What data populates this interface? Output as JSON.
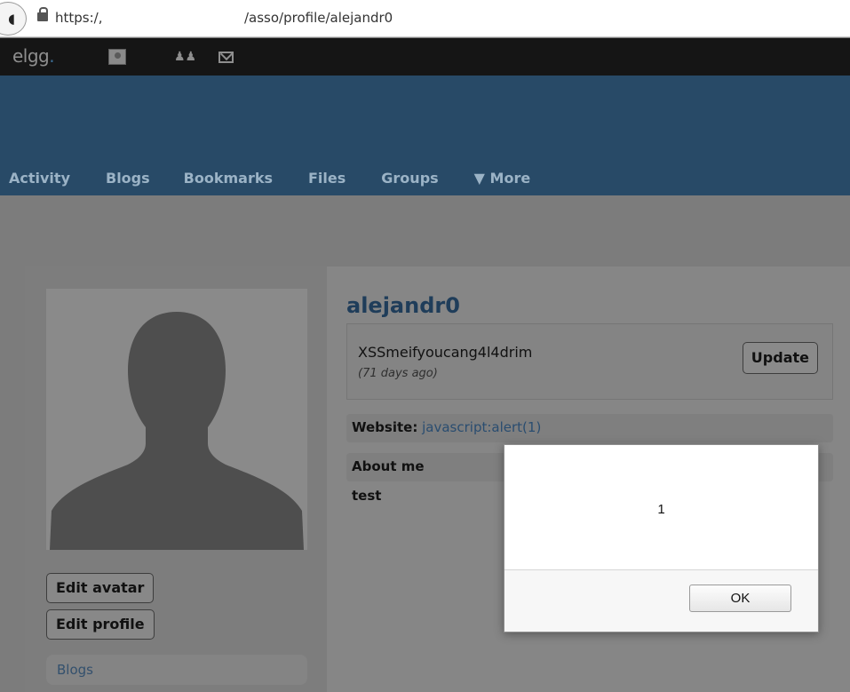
{
  "browser": {
    "url_left": "https:/,",
    "url_right": "/asso/profile/alejandr0"
  },
  "topbar": {
    "logo": "elgg",
    "logo_dot": ".",
    "icons": [
      "avatar-icon",
      "friends-icon",
      "mail-icon"
    ]
  },
  "nav": {
    "items": [
      "Activity",
      "Blogs",
      "Bookmarks",
      "Files",
      "Groups",
      "▼ More"
    ]
  },
  "profile": {
    "username": "alejandr0",
    "status_text": "XSSmeifyoucang4l4drim",
    "status_time": "(71 days ago)",
    "update_label": "Update",
    "website_label": "Website:",
    "website_value": "javascript:alert(1)",
    "about_label": "About me",
    "about_value": "test",
    "edit_avatar_label": "Edit avatar",
    "edit_profile_label": "Edit profile",
    "blogs_link": "Blogs"
  },
  "dialog": {
    "message": "1",
    "ok_label": "OK"
  },
  "colors": {
    "header_blue": "#284a67",
    "topbar_black": "#151515",
    "overlay_gray": "#7c7c7c"
  }
}
